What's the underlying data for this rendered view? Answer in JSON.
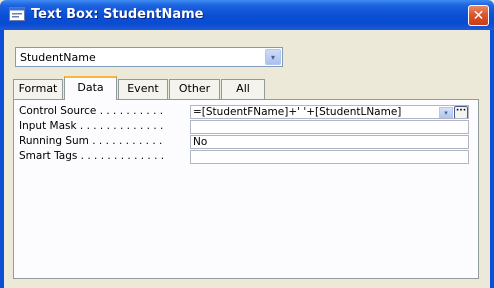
{
  "window": {
    "title": "Text Box: StudentName",
    "close_glyph": "✕",
    "icon": "textbox-properties-icon"
  },
  "selector": {
    "value": "StudentName",
    "dropdown_glyph": "▾"
  },
  "tabs": [
    {
      "label": "Format",
      "active": false
    },
    {
      "label": "Data",
      "active": true
    },
    {
      "label": "Event",
      "active": false
    },
    {
      "label": "Other",
      "active": false
    },
    {
      "label": "All",
      "active": false
    }
  ],
  "properties": [
    {
      "label": "Control Source . . . . . . . . . .",
      "value": "=[StudentFName]+' '+[StudentLName]"
    },
    {
      "label": "Input Mask . . . . . . . . . . . . .",
      "value": ""
    },
    {
      "label": "Running Sum . . . . . . . . . . .",
      "value": "No"
    },
    {
      "label": "Smart Tags . . . . . . . . . . . . .",
      "value": ""
    }
  ],
  "builder_glyph": "···",
  "colors": {
    "titlebar": "#0b4fd6",
    "active_tab_accent": "#f6b73c",
    "close_button": "#d9532a"
  }
}
